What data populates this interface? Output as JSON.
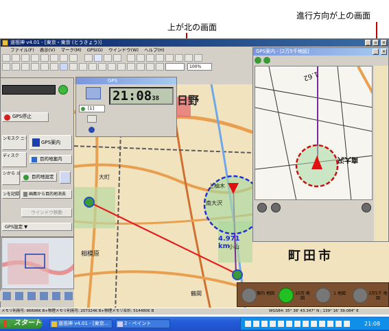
{
  "callouts": {
    "north_up": "上が北の画面",
    "heading_up": "進行方向が上の画面"
  },
  "main_window": {
    "title": "道祖神 v4.01 - [東京・東京 (とうきょう)]",
    "menus": [
      "ファイル(F)",
      "表示(V)",
      "マーク(M)",
      "GPS(G)",
      "ウインドウ(W)",
      "ヘルプ(H)"
    ],
    "zoom_select": "100%"
  },
  "gps_panel": {
    "title": "GPS",
    "clock": "21:08",
    "clock_seconds": "38",
    "channel_select": "[1]"
  },
  "side_panel": {
    "buttons": [
      "GPS停止",
      "ンモスク ニー",
      "GPS案内",
      "ディスク",
      "目的地案内",
      "シから ルーで",
      "目的地設定",
      "ンを記録",
      "画面から目的地消去",
      "ウインドウ移動"
    ],
    "gps_settings": "GPS設定 ▼"
  },
  "map": {
    "distance_label": "4.971 km",
    "city_label": "町田市",
    "places": [
      "日野",
      "上柚木",
      "南大沢",
      "相模原",
      "鶴間",
      "大町",
      "小山"
    ]
  },
  "guide_window": {
    "title": "GPS案内 - [2万5千地図]",
    "places": [
      "南大沢",
      "1.62"
    ]
  },
  "scale_panel": {
    "buttons": [
      {
        "label": "案内 地図",
        "active": false
      },
      {
        "label": "20万 地図",
        "active": true
      },
      {
        "label": "1 地図",
        "active": false
      },
      {
        "label": "2万5千 地図",
        "active": false
      }
    ]
  },
  "status_bar": {
    "left": "メモリ利用可: 86696K B+物理メモリ利用可: 207324K B+物理メモリ合計: 514480K B",
    "right": "WGS84: 35° 38' 43.347\" N ; 139° 16' 39.084\" E"
  },
  "taskbar": {
    "start": "スタート",
    "tasks": [
      "道祖神 v4.01 - [東京...",
      "2 - ペイント"
    ],
    "clock": "21:08"
  },
  "colors": {
    "title_active": "#0a246a",
    "route_line": "#e02020",
    "heading_arrow": "#e01010",
    "guide_circle": "#c81010",
    "map_circle_border": "#1f2fd0",
    "taskbar": "#245edb",
    "start_button": "#2e8b2e"
  }
}
